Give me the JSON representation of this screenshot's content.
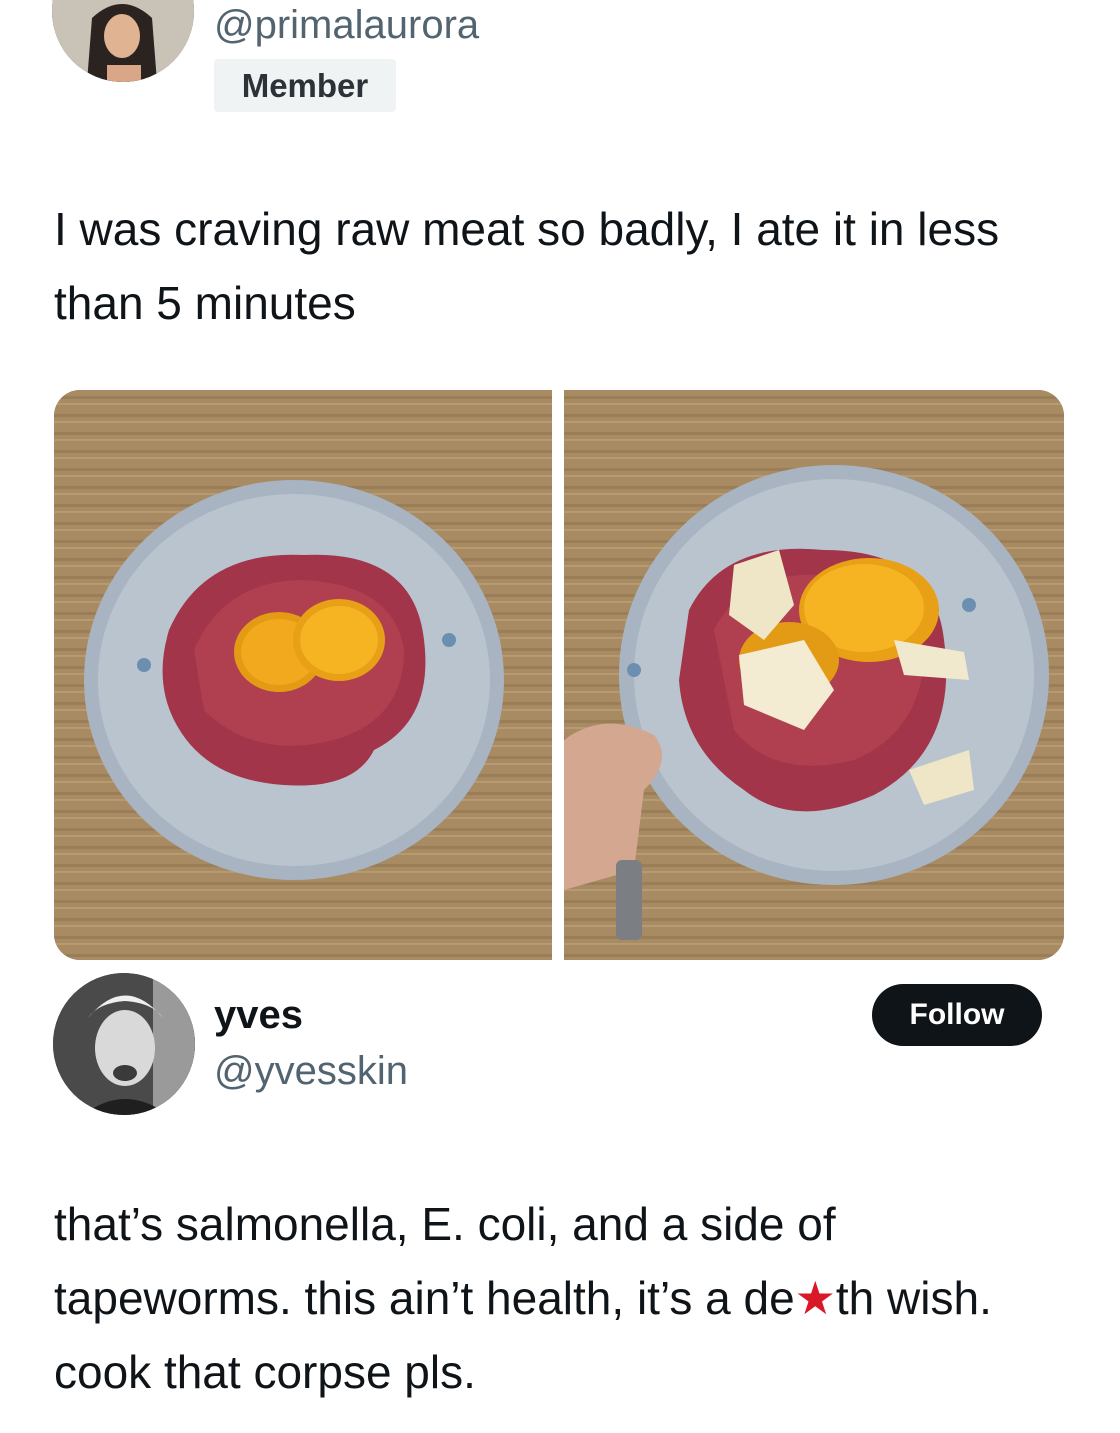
{
  "post": {
    "handle": "@primalaurora",
    "badge": "Member",
    "text": "I was craving raw meat so badly, I ate it in less than 5 minutes"
  },
  "reply": {
    "name": "yves",
    "handle": "@yvesskin",
    "follow_label": "Follow",
    "text_before": "that’s salmonella, E. coli, and a side of tapeworms. this ain’t health, it’s a de",
    "star": "★",
    "text_after": "th wish. cook that corpse pls."
  },
  "colors": {
    "text": "#0f1419",
    "secondary": "#536471",
    "badge_bg": "#eff3f4",
    "follow_bg": "#0f1419",
    "star": "#d81a28"
  }
}
